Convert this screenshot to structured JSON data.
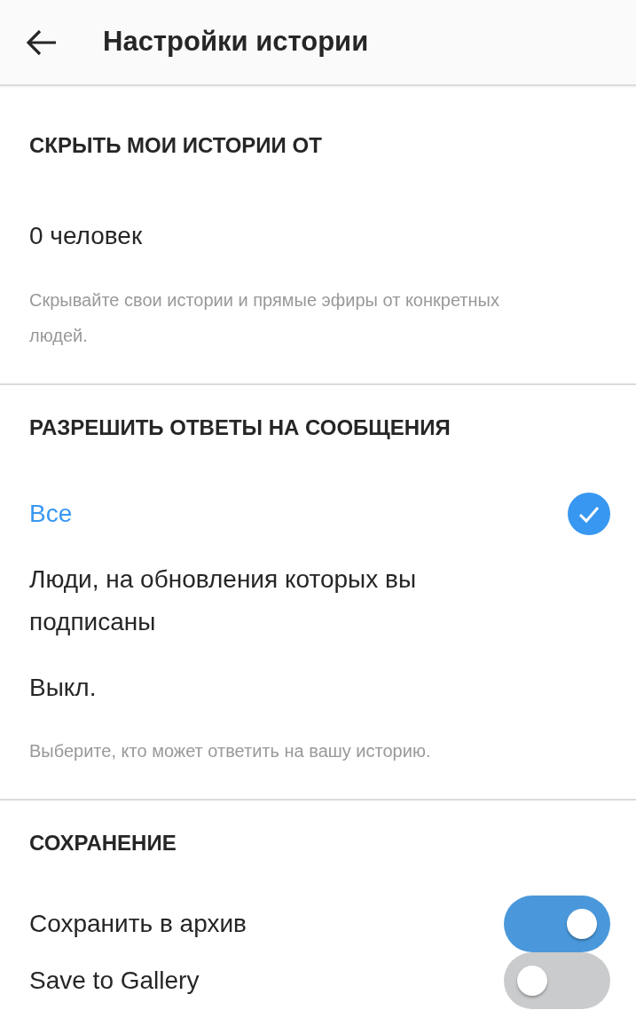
{
  "header": {
    "title": "Настройки истории"
  },
  "sections": [
    {
      "kind": "value",
      "heading": "СКРЫТЬ МОИ ИСТОРИИ ОТ",
      "value": "0 человек",
      "hint": "Скрывайте свои истории и прямые эфиры от конкретных людей."
    },
    {
      "kind": "options",
      "heading": "РАЗРЕШИТЬ ОТВЕТЫ НА СООБЩЕНИЯ",
      "options": [
        {
          "label": "Все",
          "selected": true
        },
        {
          "label": "Люди, на обновления которых вы подписаны",
          "selected": false
        },
        {
          "label": "Выкл.",
          "selected": false
        }
      ],
      "hint": "Выберите, кто может ответить на вашу историю."
    },
    {
      "kind": "toggles",
      "heading": "СОХРАНЕНИЕ",
      "toggles": [
        {
          "label": "Сохранить в архив",
          "on": true
        },
        {
          "label": "Save to Gallery",
          "on": false
        }
      ]
    }
  ]
}
